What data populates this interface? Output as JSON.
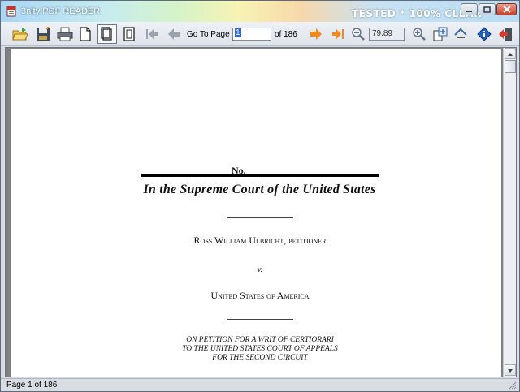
{
  "window": {
    "title": "3nity PDF READER",
    "watermark": "TESTED * 100% CLEAN"
  },
  "toolbar": {
    "buttons": [
      "open-icon",
      "save-icon",
      "print-icon",
      "blank-page-icon",
      "single-page-icon",
      "continuous-page-icon",
      "first-page-icon",
      "previous-page-icon",
      "next-page-icon",
      "last-page-icon",
      "zoom-out-icon",
      "zoom-in-icon",
      "fit-page-icon",
      "rotate-icon",
      "info-icon",
      "exit-icon"
    ],
    "go_to_page_label": "Go To Page",
    "page_value": "1",
    "page_total_label": "of 186",
    "zoom_value": "79.89"
  },
  "document": {
    "number_label": "No.",
    "court_title": "In the Supreme Court of the United States",
    "petitioner": "Ross William Ulbricht, petitioner",
    "versus": "v.",
    "respondent": "United States of America",
    "petition_lines": [
      "ON PETITION FOR A WRIT OF CERTIORARI",
      "TO THE UNITED STATES COURT OF APPEALS",
      "FOR THE SECOND CIRCUIT"
    ]
  },
  "statusbar": {
    "text": "Page 1 of 186"
  },
  "colors": {
    "arrow_orange": "#f08a1c",
    "arrow_gray": "#9aa3ae",
    "info_blue": "#1f5fbf"
  }
}
